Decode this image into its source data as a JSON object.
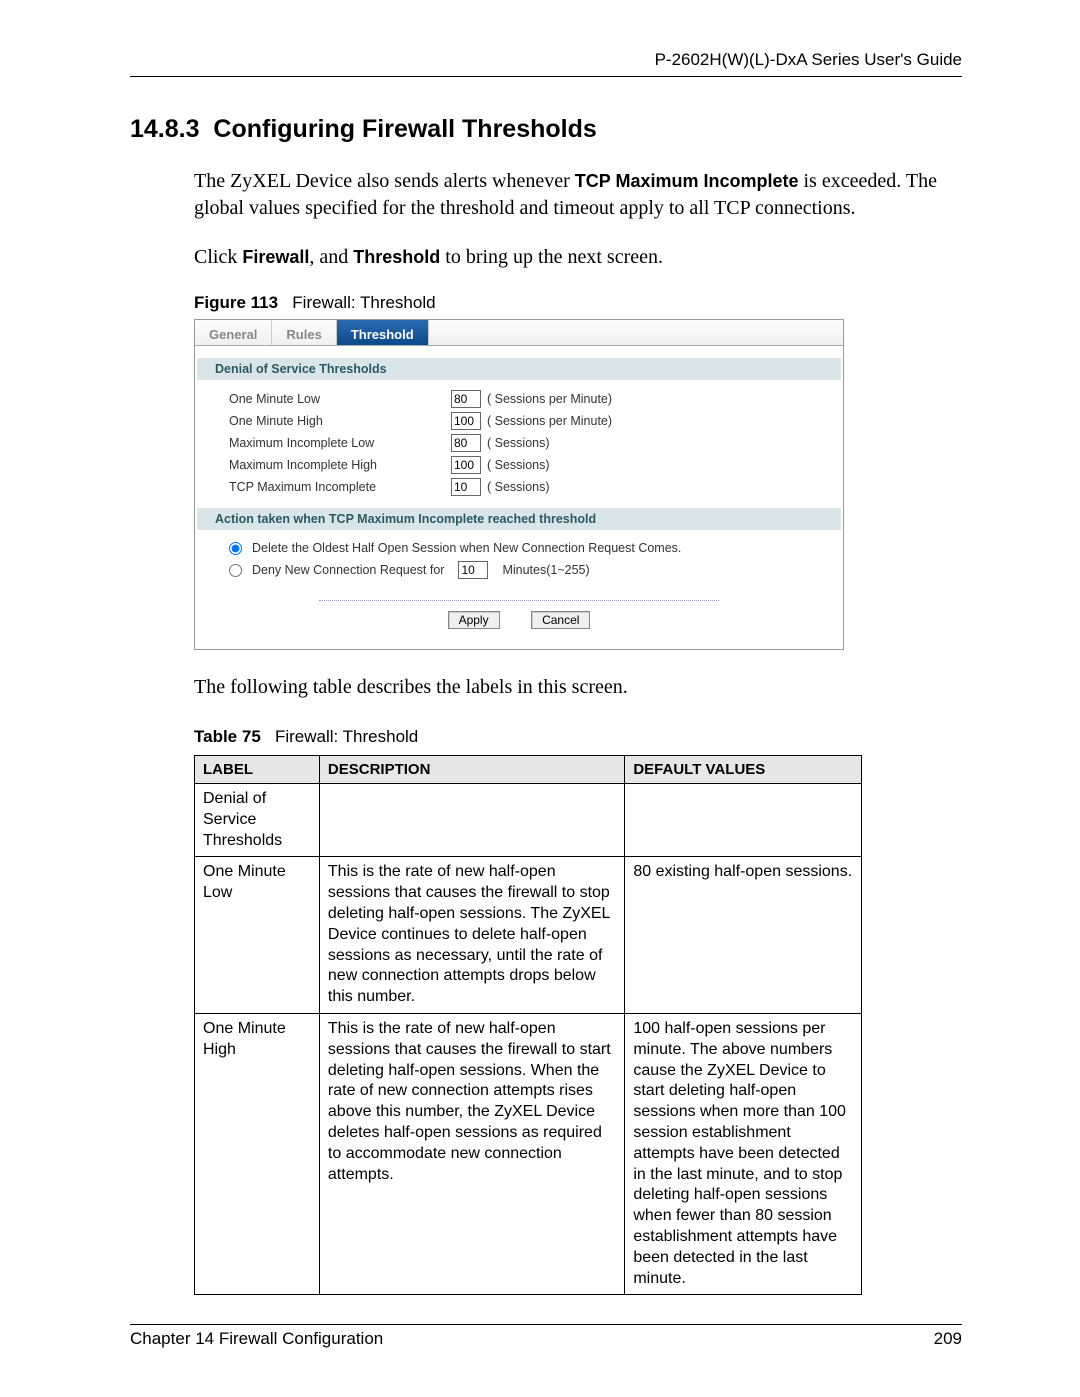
{
  "header": {
    "guide_title": "P-2602H(W)(L)-DxA Series User's Guide"
  },
  "section": {
    "number": "14.8.3",
    "title": "Configuring Firewall Thresholds"
  },
  "para1_a": "The ZyXEL Device also sends alerts whenever ",
  "para1_b": "TCP Maximum Incomplete",
  "para1_c": " is exceeded. The global values specified for the threshold and timeout apply to all TCP connections.",
  "para2_a": "Click ",
  "para2_b": "Firewall",
  "para2_c": ", and ",
  "para2_d": "Threshold",
  "para2_e": " to bring up the next screen.",
  "figure": {
    "num": "Figure 113",
    "caption": "Firewall: Threshold"
  },
  "tabs": {
    "general": "General",
    "rules": "Rules",
    "threshold": "Threshold"
  },
  "dos": {
    "head": "Denial of Service Thresholds",
    "rows": [
      {
        "label": "One Minute Low",
        "value": "80",
        "suffix": "( Sessions per Minute)"
      },
      {
        "label": "One Minute High",
        "value": "100",
        "suffix": "( Sessions per Minute)"
      },
      {
        "label": "Maximum Incomplete Low",
        "value": "80",
        "suffix": "( Sessions)"
      },
      {
        "label": "Maximum Incomplete High",
        "value": "100",
        "suffix": "( Sessions)"
      },
      {
        "label": "TCP Maximum Incomplete",
        "value": "10",
        "suffix": "( Sessions)"
      }
    ]
  },
  "action": {
    "head": "Action taken when TCP Maximum Incomplete reached threshold",
    "opt1": "Delete the Oldest Half Open Session when New Connection Request Comes.",
    "opt2_a": "Deny New Connection Request for",
    "opt2_val": "10",
    "opt2_b": "Minutes(1~255)"
  },
  "buttons": {
    "apply": "Apply",
    "cancel": "Cancel"
  },
  "para3": "The following table describes the labels in this screen.",
  "table_caption": {
    "num": "Table 75",
    "caption": "Firewall: Threshold"
  },
  "table": {
    "headers": {
      "label": "LABEL",
      "desc": "DESCRIPTION",
      "def": "DEFAULT VALUES"
    },
    "rows": [
      {
        "label": "Denial of Service Thresholds",
        "desc": "",
        "def": ""
      },
      {
        "label": "One Minute Low",
        "desc": "This is the rate of new half-open sessions that causes the firewall to stop deleting half-open sessions. The ZyXEL Device continues to delete half-open sessions as necessary, until the rate of new connection attempts drops below this number.",
        "def": "80 existing half-open sessions."
      },
      {
        "label": "One Minute High",
        "desc": "This is the rate of new half-open sessions that causes the firewall to start deleting half-open sessions. When the rate of new connection attempts rises above this number, the ZyXEL Device deletes half-open sessions as required to accommodate new connection attempts.",
        "def": "100 half-open sessions per minute. The above numbers cause the ZyXEL Device to start deleting half-open sessions when more than 100 session establishment attempts have been detected in the last minute, and to stop deleting half-open sessions when fewer than 80 session establishment attempts have been detected in the last minute."
      }
    ]
  },
  "footer": {
    "chapter": "Chapter 14 Firewall Configuration",
    "page": "209"
  }
}
